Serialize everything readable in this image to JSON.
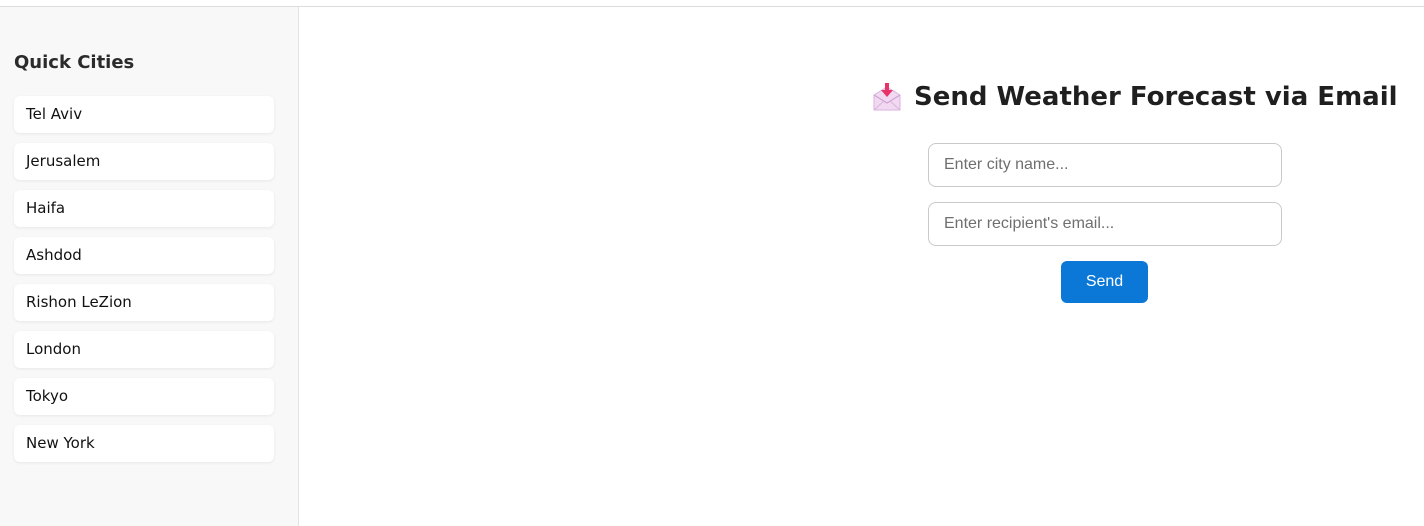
{
  "sidebar": {
    "title": "Quick Cities",
    "cities": [
      "Tel Aviv",
      "Jerusalem",
      "Haifa",
      "Ashdod",
      "Rishon LeZion",
      "London",
      "Tokyo",
      "New York"
    ]
  },
  "main": {
    "heading_icon": "incoming-envelope-icon",
    "heading": "Send Weather Forecast via Email",
    "city_input": {
      "placeholder": "Enter city name...",
      "value": ""
    },
    "email_input": {
      "placeholder": "Enter recipient's email...",
      "value": ""
    },
    "send_label": "Send"
  },
  "colors": {
    "accent": "#0b78d7",
    "sidebar_bg": "#f8f8f8",
    "icon_arrow": "#e8336a",
    "icon_envelope": "#e9c8ea"
  }
}
